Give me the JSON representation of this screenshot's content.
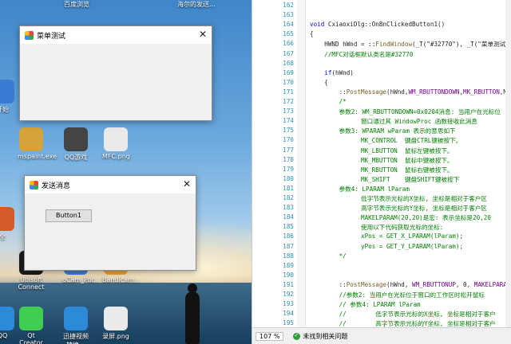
{
  "desktop": {
    "top_labels": [
      "百度浏览",
      "海尔的发送..."
    ],
    "icons": [
      {
        "label": "开始",
        "color": "#3a7bd5"
      },
      {
        "label": "mspaint.exe",
        "color": "#d4a43a"
      },
      {
        "label": "QQ游戏",
        "color": "#444444"
      },
      {
        "label": "MFC.png",
        "color": "#eaeaea"
      },
      {
        "label": "全",
        "color": "#d65a2a"
      },
      {
        "label": "Ubisoft Connect",
        "color": "#1b1b1b"
      },
      {
        "label": "oCam_Por...",
        "color": "#3f7fd0"
      },
      {
        "label": "Bandicam...",
        "color": "#e8a23a"
      },
      {
        "label": "QQ",
        "color": "#2d8ad8"
      },
      {
        "label": "Qt Creator",
        "color": "#41cd52"
      },
      {
        "label": "迅捷视频转换...",
        "color": "#2d8ad8"
      },
      {
        "label": "录屏.png",
        "color": "#eaeaea"
      }
    ]
  },
  "windows": {
    "menu_test": {
      "title": "菜单测试"
    },
    "send_msg": {
      "title": "发送消息",
      "button_label": "Button1"
    }
  },
  "editor": {
    "zoom": "107 %",
    "status_text": "未找到相关问题",
    "lines": [
      {
        "n": "162",
        "t": ""
      },
      {
        "n": "163",
        "t": ""
      },
      {
        "n": "164",
        "t": "void CxiaoxiDlg::OnBnClickedButton1()"
      },
      {
        "n": "165",
        "t": "{"
      },
      {
        "n": "166",
        "t": "    HWND hWnd = ::FindWindow(_T(\"#32770\"), _T(\"菜单测试"
      },
      {
        "n": "167",
        "t": "    //MFC对话框默认类名是#32770"
      },
      {
        "n": "168",
        "t": ""
      },
      {
        "n": "169",
        "t": "    if(hWnd)"
      },
      {
        "n": "170",
        "t": "    {"
      },
      {
        "n": "171",
        "t": "        ::PostMessage(hWnd,WM_RBUTTONDOWN,MK_RBUTTON,MA"
      },
      {
        "n": "172",
        "t": "        /*"
      },
      {
        "n": "173",
        "t": "        参数2: WM_RBUTTONDOWN=0x0204消息: 当用户在光标位"
      },
      {
        "n": "174",
        "t": "              窗口通过其 WindowProc 函数接收此消息"
      },
      {
        "n": "175",
        "t": "        参数3: WPARAM wParam 表示的意思如下"
      },
      {
        "n": "176",
        "t": "              MK_CONTROL  键盘CTRL键被按下。"
      },
      {
        "n": "177",
        "t": "              MK_LBUTTON  鼠标左键被按下。"
      },
      {
        "n": "178",
        "t": "              MK_MBUTTON  鼠标中键被按下。"
      },
      {
        "n": "179",
        "t": "              MK_RBUTTON  鼠标右键被按下。"
      },
      {
        "n": "180",
        "t": "              MK_SHIFT    键盘SHIFT键被按下"
      },
      {
        "n": "181",
        "t": "        参数4: LPARAM lParam"
      },
      {
        "n": "182",
        "t": "              低字节表示光标的X坐标, 坐标是相对于客户区"
      },
      {
        "n": "183",
        "t": "              高字节表示光标的Y坐标, 坐标是相对于客户区"
      },
      {
        "n": "184",
        "t": "              MAKELPARAM(20,20)是宏: 表示坐标是20,20"
      },
      {
        "n": "185",
        "t": "              使用以下代码获取光标的坐标:"
      },
      {
        "n": "186",
        "t": "              xPos = GET_X_LPARAM(lParam);"
      },
      {
        "n": "187",
        "t": "              yPos = GET_Y_LPARAM(lParam);"
      },
      {
        "n": "188",
        "t": "        */"
      },
      {
        "n": "189",
        "t": ""
      },
      {
        "n": "190",
        "t": ""
      },
      {
        "n": "191",
        "t": "        ::PostMessage(hWnd, WM_RBUTTONUP, 0, MAKELPARAM"
      },
      {
        "n": "192",
        "t": "        //参数2: 当用户在光标位于窗口的工作区时松开鼠标"
      },
      {
        "n": "193",
        "t": "        // 参数4: LPARAM lParam"
      },
      {
        "n": "194",
        "t": "        //        低字节表示光标的X坐标, 坐标是相对于客户"
      },
      {
        "n": "195",
        "t": "        //        高字节表示光标的Y坐标, 坐标是相对于客户"
      }
    ]
  }
}
